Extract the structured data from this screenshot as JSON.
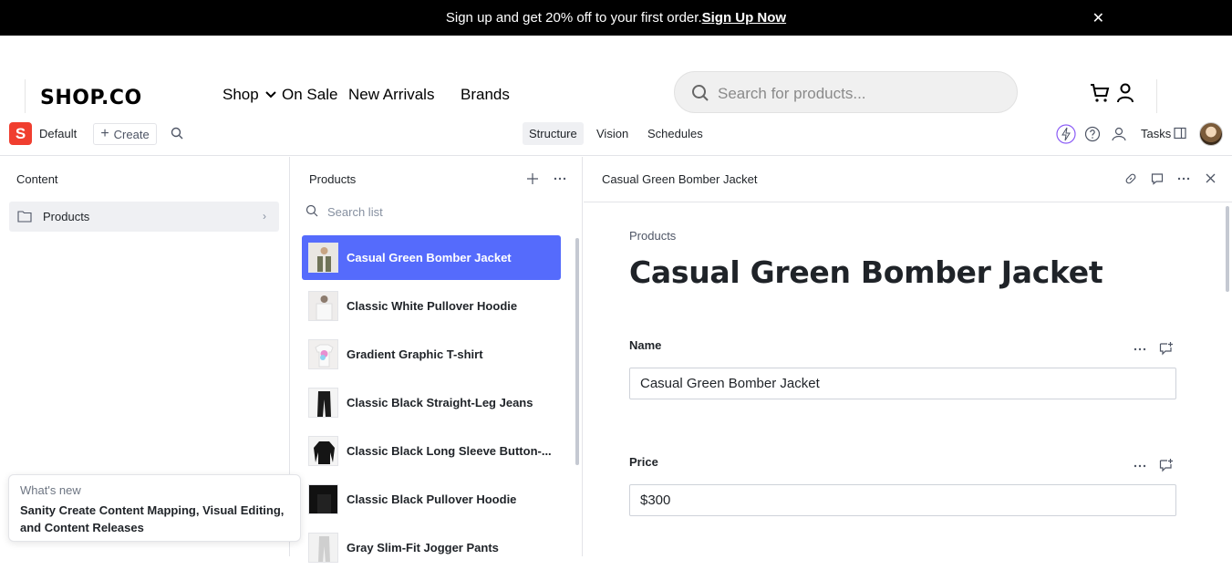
{
  "promo": {
    "text": "Sign up and get 20% off to your first order.",
    "link": "Sign Up Now"
  },
  "site": {
    "logo": "SHOP.CO",
    "nav": [
      "Shop",
      "On Sale",
      "New Arrivals",
      "Brands"
    ],
    "search_placeholder": "Search for products..."
  },
  "toolbar": {
    "workspace_letter": "S",
    "workspace": "Default",
    "create_label": "Create",
    "tabs": [
      "Structure",
      "Vision",
      "Schedules"
    ],
    "active_tab": "Structure",
    "tasks_label": "Tasks"
  },
  "content_pane": {
    "title": "Content",
    "items": [
      {
        "label": "Products"
      }
    ]
  },
  "list_pane": {
    "title": "Products",
    "search_placeholder": "Search list",
    "items": [
      {
        "name": "Casual Green Bomber Jacket",
        "selected": true
      },
      {
        "name": "Classic White Pullover Hoodie"
      },
      {
        "name": "Gradient Graphic T-shirt"
      },
      {
        "name": "Classic Black Straight-Leg Jeans"
      },
      {
        "name": "Classic Black Long Sleeve Button-..."
      },
      {
        "name": "Classic Black Pullover Hoodie"
      },
      {
        "name": "Gray Slim-Fit Jogger Pants"
      }
    ]
  },
  "document": {
    "header_title": "Casual Green Bomber Jacket",
    "breadcrumb": "Products",
    "title": "Casual Green Bomber Jacket",
    "fields": [
      {
        "label": "Name",
        "value": "Casual Green Bomber Jacket"
      },
      {
        "label": "Price",
        "value": "$300"
      }
    ]
  },
  "whats_new": {
    "heading": "What's new",
    "body": "Sanity Create Content Mapping, Visual Editing, and Content Releases"
  },
  "colors": {
    "selected": "#556bfc",
    "brand": "#f03e2f",
    "banner": "#000000"
  }
}
